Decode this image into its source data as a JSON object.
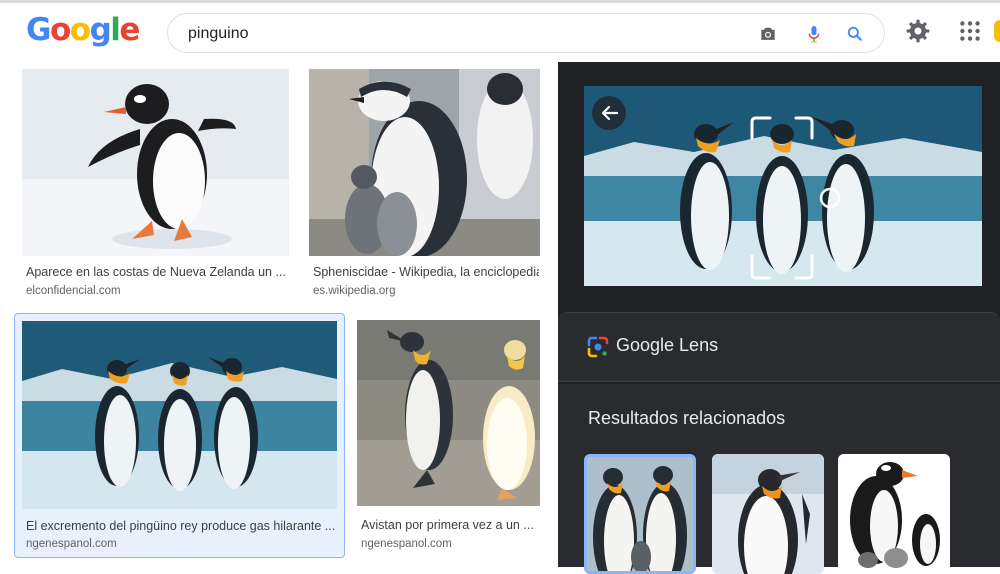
{
  "header": {
    "logo_letters": [
      "G",
      "o",
      "o",
      "g",
      "l",
      "e"
    ],
    "search_value": "pinguino",
    "icons": [
      "camera-icon",
      "mic-icon",
      "search-icon",
      "settings-icon",
      "apps-icon"
    ]
  },
  "results": [
    {
      "title": "Aparece en las costas de Nueva Zelanda un ...",
      "source": "elconfidencial.com"
    },
    {
      "title": "Spheniscidae - Wikipedia, la enciclopedia ...",
      "source": "es.wikipedia.org"
    },
    {
      "title": "El excremento del pingüino rey produce gas hilarante ...",
      "source": "ngenespanol.com"
    },
    {
      "title": "Avistan por primera vez a un ...",
      "source": "ngenespanol.com"
    }
  ],
  "panel": {
    "lens_label": "Google Lens",
    "related_title": "Resultados relacionados"
  },
  "colors": {
    "google_blue": "#4285f4",
    "google_red": "#ea4335",
    "google_yellow": "#fbbc05",
    "google_green": "#34a853",
    "panel_bg": "#202124",
    "selected_border": "#8ab4f8"
  }
}
